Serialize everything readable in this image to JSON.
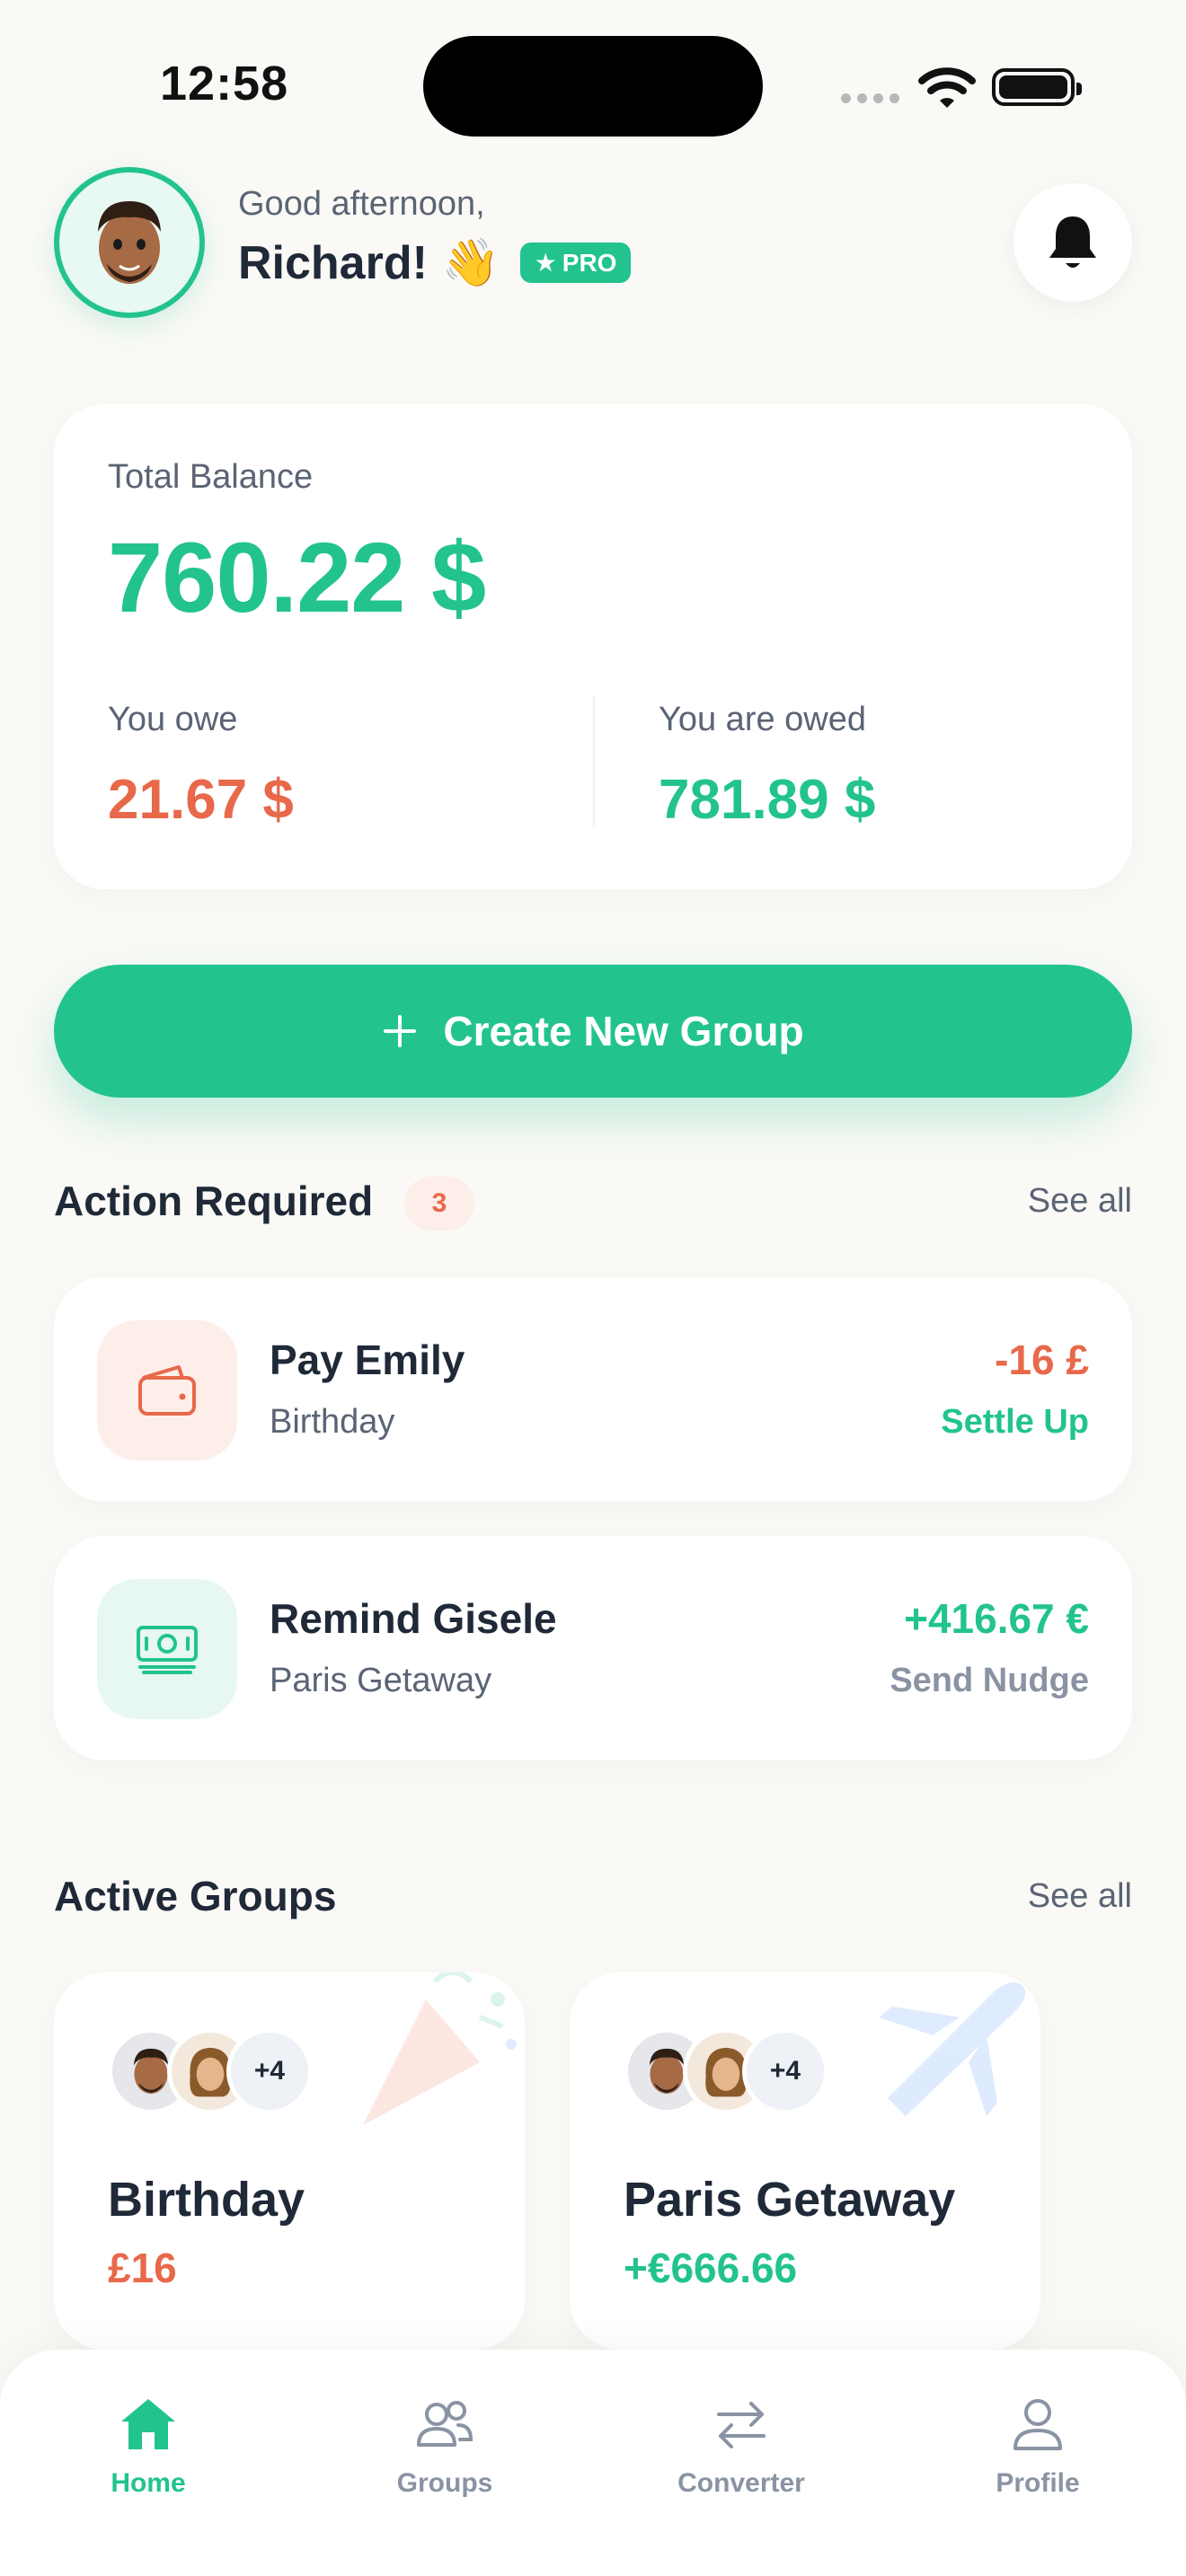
{
  "status_bar": {
    "time": "12:58"
  },
  "header": {
    "greeting": "Good afternoon,",
    "name": "Richard!",
    "wave_emoji": "👋",
    "badge": "PRO",
    "badge_icon": "★",
    "bell_icon": "bell-icon"
  },
  "balance": {
    "label": "Total Balance",
    "total": "760.22 $",
    "owe_label": "You owe",
    "owe_value": "21.67 $",
    "owed_label": "You are owed",
    "owed_value": "781.89 $"
  },
  "create_group": {
    "label": "Create New Group",
    "icon": "plus-icon"
  },
  "action_required": {
    "title": "Action Required",
    "count": "3",
    "see_all": "See all",
    "items": [
      {
        "title": "Pay Emily",
        "subtitle": "Birthday",
        "amount": "-16 £",
        "cta": "Settle Up",
        "icon": "wallet-icon"
      },
      {
        "title": "Remind Gisele",
        "subtitle": "Paris Getaway",
        "amount": "+416.67 €",
        "cta": "Send Nudge",
        "icon": "cash-icon"
      }
    ]
  },
  "active_groups": {
    "title": "Active Groups",
    "see_all": "See all",
    "groups": [
      {
        "name": "Birthday",
        "amount": "£16",
        "more": "+4",
        "decor_icon": "party-popper-icon"
      },
      {
        "name": "Paris Getaway",
        "amount": "+€666.66",
        "more": "+4",
        "decor_icon": "airplane-icon"
      }
    ]
  },
  "tabs": [
    {
      "label": "Home",
      "icon": "home-icon"
    },
    {
      "label": "Groups",
      "icon": "groups-icon"
    },
    {
      "label": "Converter",
      "icon": "swap-icon"
    },
    {
      "label": "Profile",
      "icon": "profile-icon"
    }
  ],
  "colors": {
    "accent": "#22C38E",
    "negative": "#E8684A",
    "text": "#1F2937",
    "muted": "#5B6475",
    "background": "#FAF9F6"
  }
}
